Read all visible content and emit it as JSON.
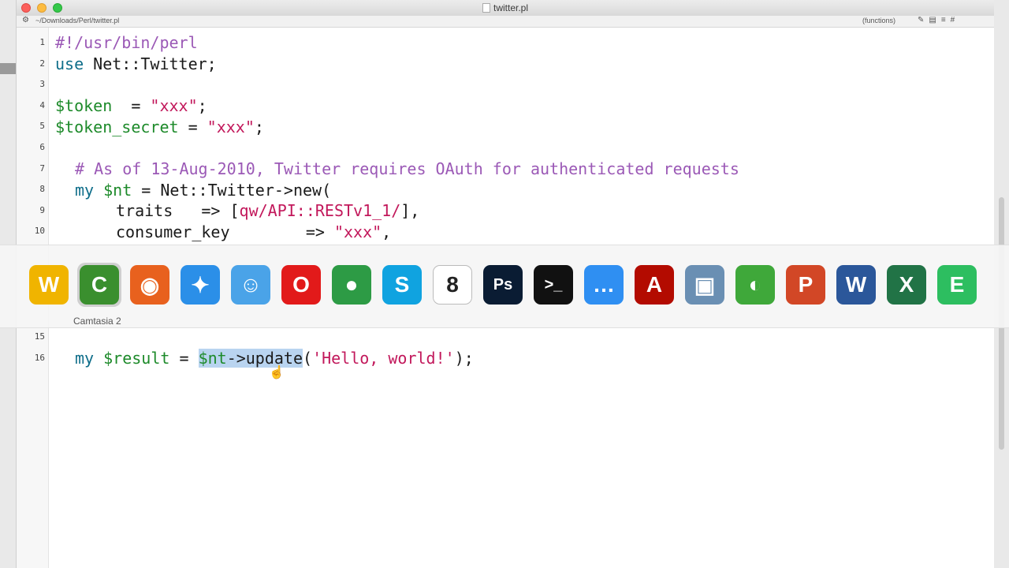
{
  "window": {
    "title": "twitter.pl",
    "path": "~/Downloads/Perl/twitter.pl",
    "functions_label": "(functions)"
  },
  "editor": {
    "line_numbers": [
      "1",
      "2",
      "3",
      "4",
      "5",
      "6",
      "7",
      "8",
      "9",
      "10",
      "15",
      "16"
    ],
    "lines": {
      "l1": "#!/usr/bin/perl",
      "l2_kw": "use",
      "l2_rest": " Net::Twitter;",
      "l4_var": "$token",
      "l4_mid": "  = ",
      "l4_str": "\"xxx\"",
      "l4_end": ";",
      "l5_var": "$token_secret",
      "l5_mid": " = ",
      "l5_str": "\"xxx\"",
      "l5_end": ";",
      "l7_cmt": "# As of 13-Aug-2010, Twitter requires OAuth for authenticated requests",
      "l8_kw": "my",
      "l8_var": "$nt",
      "l8_rest": " = Net::Twitter->new(",
      "l9_a": "traits   => [",
      "l9_str": "qw/API::RESTv1_1/",
      "l9_end": "],",
      "l10_a": "consumer_key        => ",
      "l10_str": "\"xxx\"",
      "l10_end": ",",
      "l16_kw": "my",
      "l16_var": "$result",
      "l16_eq": " = ",
      "l16_sel_var": "$nt",
      "l16_sel_rest": "->update",
      "l16_open": "(",
      "l16_str": "'Hello, world!'",
      "l16_end": ");"
    }
  },
  "dock": {
    "hover_label": "Camtasia 2",
    "apps": [
      {
        "name": "ietf-app-icon",
        "glyph": "W",
        "color": "#f0b400"
      },
      {
        "name": "camtasia-icon",
        "glyph": "C",
        "color": "#3a8f2e"
      },
      {
        "name": "firefox-icon",
        "glyph": "◉",
        "color": "#e8611e"
      },
      {
        "name": "safari-icon",
        "glyph": "✦",
        "color": "#2b8fe8"
      },
      {
        "name": "finder-icon",
        "glyph": "☺",
        "color": "#4aa3e8"
      },
      {
        "name": "opera-icon",
        "glyph": "O",
        "color": "#e21a1a"
      },
      {
        "name": "chrome-icon",
        "glyph": "●",
        "color": "#2d9b45"
      },
      {
        "name": "skype-icon",
        "glyph": "S",
        "color": "#10a3e0"
      },
      {
        "name": "calendar-icon",
        "glyph": "8",
        "color": "#ffffff"
      },
      {
        "name": "photoshop-icon",
        "glyph": "Ps",
        "color": "#0a1c33"
      },
      {
        "name": "terminal-icon",
        "glyph": ">_",
        "color": "#111111"
      },
      {
        "name": "messages-icon",
        "glyph": "…",
        "color": "#2f8ff2"
      },
      {
        "name": "acrobat-icon",
        "glyph": "A",
        "color": "#b30b00"
      },
      {
        "name": "preview-icon",
        "glyph": "▣",
        "color": "#6a8fb3"
      },
      {
        "name": "adium-icon",
        "glyph": "◐",
        "color": "#3fa83a"
      },
      {
        "name": "powerpoint-icon",
        "glyph": "P",
        "color": "#d24726"
      },
      {
        "name": "word-icon",
        "glyph": "W",
        "color": "#2b579a"
      },
      {
        "name": "excel-icon",
        "glyph": "X",
        "color": "#217346"
      },
      {
        "name": "evernote-icon",
        "glyph": "E",
        "color": "#2dbe60"
      }
    ]
  }
}
